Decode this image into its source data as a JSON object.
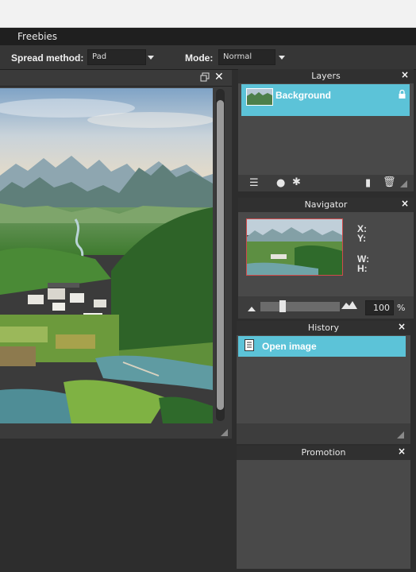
{
  "menubar": {
    "freebies": "Freebies"
  },
  "options": {
    "spread_label": "Spread method:",
    "spread_value": "Pad",
    "mode_label": "Mode:",
    "mode_value": "Normal"
  },
  "canvas": {
    "restore_icon": "restore-icon",
    "close_icon": "close-icon"
  },
  "layers": {
    "title": "Layers",
    "items": [
      {
        "label": "Background",
        "locked": true
      }
    ]
  },
  "navigator": {
    "title": "Navigator",
    "x_label": "X:",
    "y_label": "Y:",
    "w_label": "W:",
    "h_label": "H:",
    "zoom_value": "100",
    "zoom_unit": "%"
  },
  "history": {
    "title": "History",
    "items": [
      {
        "label": "Open image"
      }
    ]
  },
  "promotion": {
    "title": "Promotion"
  },
  "colors": {
    "accent": "#5cc3d8",
    "panel": "#494949",
    "titlebar": "#303030"
  }
}
